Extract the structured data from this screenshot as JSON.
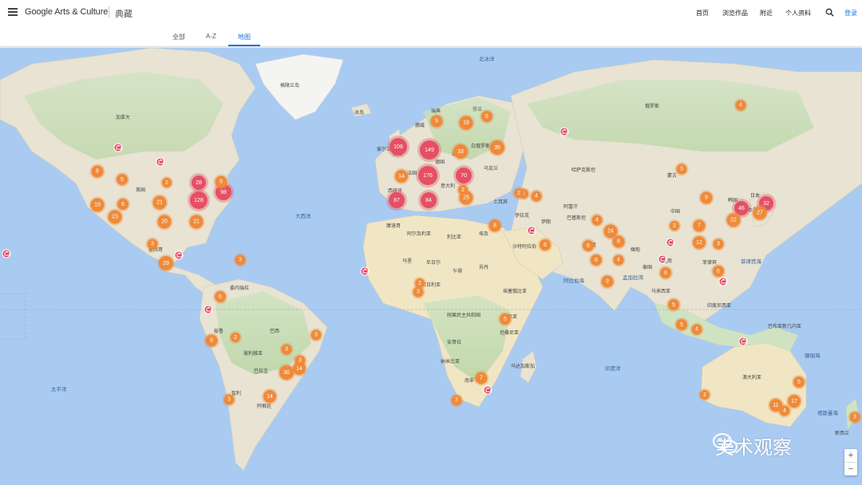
{
  "header": {
    "brand": "Google Arts & Culture",
    "section": "典藏",
    "nav": [
      "首页",
      "浏览作品",
      "附近",
      "个人资料"
    ],
    "login": "登录"
  },
  "tabs": [
    "全部",
    "A-Z",
    "地图"
  ],
  "active_tab": "地图",
  "colors": {
    "ocean": "#a9cbf2",
    "land": "#f1ece0",
    "cluster_orange": "#ee8a3a",
    "cluster_red": "#e55064",
    "accent": "#1a73e8"
  },
  "map": {
    "place_labels": [
      "格陵兰岛",
      "加拿大",
      "美国",
      "墨西哥",
      "委内瑞拉",
      "秘鲁",
      "巴西",
      "玻利维亚",
      "巴拉圭",
      "阿根廷",
      "智利",
      "冰岛",
      "瑞典",
      "芬兰",
      "挪威",
      "英国",
      "爱尔兰",
      "德国",
      "法国",
      "西班牙",
      "意大利",
      "波兰",
      "乌克兰",
      "白俄罗斯",
      "土耳其",
      "伊拉克",
      "伊朗",
      "沙特阿拉伯",
      "埃及",
      "利比亚",
      "阿尔及利亚",
      "摩洛哥",
      "尼日尔",
      "马里",
      "尼日利亚",
      "乍得",
      "苏丹",
      "埃塞俄比亚",
      "肯尼亚",
      "刚果民主共和国",
      "安哥拉",
      "纳米比亚",
      "南非",
      "马达加斯加",
      "坦桑尼亚",
      "俄罗斯",
      "哈萨克斯坦",
      "蒙古",
      "中国",
      "印度",
      "巴基斯坦",
      "阿富汗",
      "缅甸",
      "泰国",
      "越南",
      "菲律宾",
      "印度尼西亚",
      "马来西亚",
      "日本",
      "韩国",
      "澳大利亚",
      "新西兰",
      "巴布亚新几内亚"
    ],
    "ocean_labels": [
      "太平洋",
      "大西洋",
      "印度洋",
      "北冰洋",
      "日本海",
      "珊瑚海",
      "塔斯曼海",
      "阿拉伯海",
      "孟加拉湾",
      "菲律宾海"
    ],
    "clusters": [
      {
        "n": "106",
        "c": "red"
      },
      {
        "n": "149",
        "c": "red"
      },
      {
        "n": "176",
        "c": "red"
      },
      {
        "n": "128",
        "c": "red"
      },
      {
        "n": "98",
        "c": "red"
      },
      {
        "n": "87",
        "c": "red"
      },
      {
        "n": "84",
        "c": "red"
      },
      {
        "n": "70",
        "c": "red"
      },
      {
        "n": "46",
        "c": "red"
      },
      {
        "n": "35",
        "c": "orange"
      },
      {
        "n": "33",
        "c": "orange"
      },
      {
        "n": "32",
        "c": "red"
      },
      {
        "n": "30",
        "c": "orange"
      },
      {
        "n": "29",
        "c": "orange"
      },
      {
        "n": "28",
        "c": "orange"
      },
      {
        "n": "27",
        "c": "orange"
      },
      {
        "n": "25",
        "c": "orange"
      },
      {
        "n": "24",
        "c": "orange"
      },
      {
        "n": "23",
        "c": "orange"
      },
      {
        "n": "22",
        "c": "orange"
      },
      {
        "n": "21",
        "c": "orange"
      },
      {
        "n": "21",
        "c": "orange"
      },
      {
        "n": "20",
        "c": "orange"
      },
      {
        "n": "19",
        "c": "orange"
      },
      {
        "n": "18",
        "c": "orange"
      },
      {
        "n": "17",
        "c": "orange"
      },
      {
        "n": "14",
        "c": "orange"
      },
      {
        "n": "14",
        "c": "orange"
      },
      {
        "n": "14",
        "c": "orange"
      },
      {
        "n": "12",
        "c": "orange"
      },
      {
        "n": "11",
        "c": "orange"
      },
      {
        "n": "9",
        "c": "orange"
      },
      {
        "n": "9",
        "c": "orange"
      },
      {
        "n": "9",
        "c": "orange"
      },
      {
        "n": "9",
        "c": "orange"
      },
      {
        "n": "9",
        "c": "orange"
      },
      {
        "n": "8",
        "c": "orange"
      },
      {
        "n": "8",
        "c": "orange"
      },
      {
        "n": "8",
        "c": "orange"
      },
      {
        "n": "7",
        "c": "orange"
      },
      {
        "n": "7",
        "c": "orange"
      },
      {
        "n": "6",
        "c": "orange"
      },
      {
        "n": "6",
        "c": "orange"
      },
      {
        "n": "6",
        "c": "orange"
      },
      {
        "n": "6",
        "c": "orange"
      },
      {
        "n": "6",
        "c": "orange"
      },
      {
        "n": "6",
        "c": "orange"
      },
      {
        "n": "6",
        "c": "orange"
      },
      {
        "n": "6",
        "c": "orange"
      },
      {
        "n": "5",
        "c": "orange"
      },
      {
        "n": "5",
        "c": "orange"
      },
      {
        "n": "5",
        "c": "orange"
      },
      {
        "n": "5",
        "c": "orange"
      },
      {
        "n": "5",
        "c": "orange"
      },
      {
        "n": "4",
        "c": "orange"
      },
      {
        "n": "4",
        "c": "orange"
      },
      {
        "n": "4",
        "c": "orange"
      },
      {
        "n": "4",
        "c": "orange"
      },
      {
        "n": "4",
        "c": "orange"
      },
      {
        "n": "4",
        "c": "orange"
      },
      {
        "n": "3",
        "c": "orange"
      },
      {
        "n": "3",
        "c": "orange"
      },
      {
        "n": "3",
        "c": "orange"
      },
      {
        "n": "3",
        "c": "orange"
      },
      {
        "n": "3",
        "c": "orange"
      },
      {
        "n": "3",
        "c": "orange"
      },
      {
        "n": "3",
        "c": "orange"
      },
      {
        "n": "3",
        "c": "orange"
      },
      {
        "n": "3",
        "c": "orange"
      },
      {
        "n": "3",
        "c": "orange"
      },
      {
        "n": "3",
        "c": "orange"
      },
      {
        "n": "2",
        "c": "orange"
      },
      {
        "n": "2",
        "c": "orange"
      },
      {
        "n": "2",
        "c": "orange"
      },
      {
        "n": "2",
        "c": "orange"
      },
      {
        "n": "2",
        "c": "orange"
      },
      {
        "n": "2",
        "c": "orange"
      },
      {
        "n": "2",
        "c": "orange"
      },
      {
        "n": "2",
        "c": "orange"
      }
    ],
    "zoom_in": "+",
    "zoom_out": "−"
  },
  "watermark": {
    "text": "美术观察",
    "icon": "wechat-icon"
  }
}
